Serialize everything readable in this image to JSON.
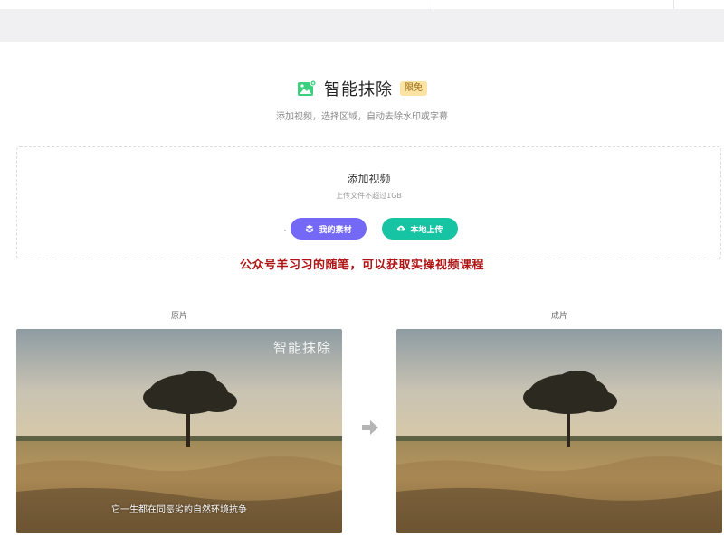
{
  "header": {
    "title": "智能抹除",
    "badge": "限免",
    "subtitle": "添加视频，选择区域，自动去除水印或字幕"
  },
  "upload": {
    "title": "添加视频",
    "hint": "上传文件不超过1GB",
    "material_button": "我的素材",
    "local_upload_button": "本地上传"
  },
  "promo_watermark": "公众号羊习习的随笔，可以获取实操视频课程",
  "compare": {
    "original_label": "原片",
    "result_label": "成片",
    "overlay_brand": "智能抹除",
    "overlay_subtitle": "它一生都在同恶劣的自然环境抗争"
  },
  "colors": {
    "material_button": "#7468f7",
    "upload_button": "#16c4a3",
    "badge_bg": "#fbe3a4",
    "promo_text": "#b01515"
  }
}
